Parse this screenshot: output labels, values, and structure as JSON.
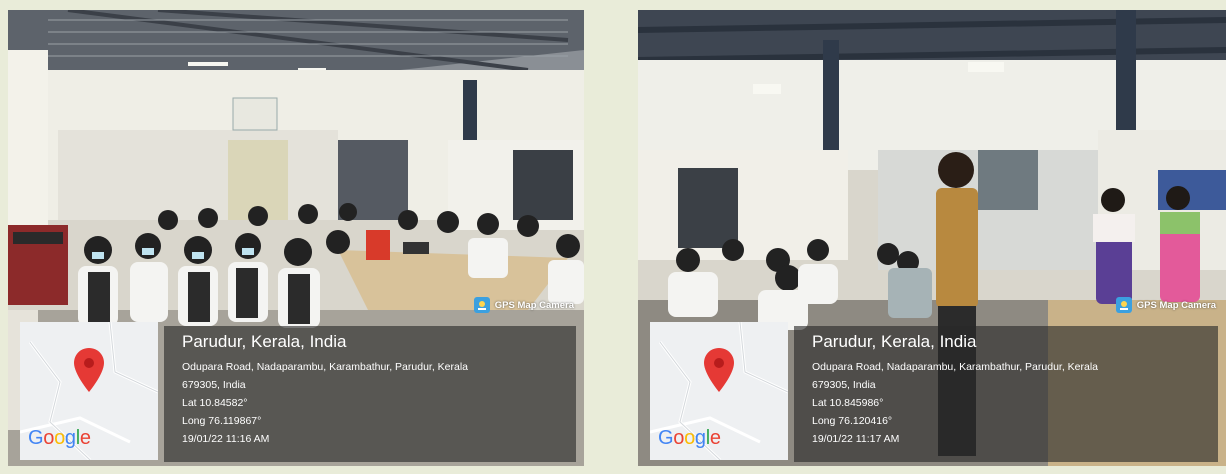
{
  "photos": [
    {
      "badge": "GPS Map Camera",
      "map_logo": "Google",
      "title": "Parudur, Kerala, India",
      "address_line1": "Odupara Road, Nadaparambu, Karambathur, Parudur, Kerala",
      "address_line2": "679305, India",
      "lat": "Lat 10.84582°",
      "long": "Long 76.119867°",
      "timestamp": "19/01/22 11:16 AM",
      "pin_color": "#e53935"
    },
    {
      "badge": "GPS Map Camera",
      "map_logo": "Google",
      "title": "Parudur, Kerala, India",
      "address_line1": "Odupara Road, Nadaparambu, Karambathur, Parudur, Kerala",
      "address_line2": "679305, India",
      "lat": "Lat 10.845986°",
      "long": "Long 76.120416°",
      "timestamp": "19/01/22 11:17 AM",
      "pin_color": "#e53935"
    }
  ],
  "google_colors": [
    "#4285F4",
    "#EA4335",
    "#FBBC05",
    "#4285F4",
    "#34A853",
    "#EA4335"
  ]
}
